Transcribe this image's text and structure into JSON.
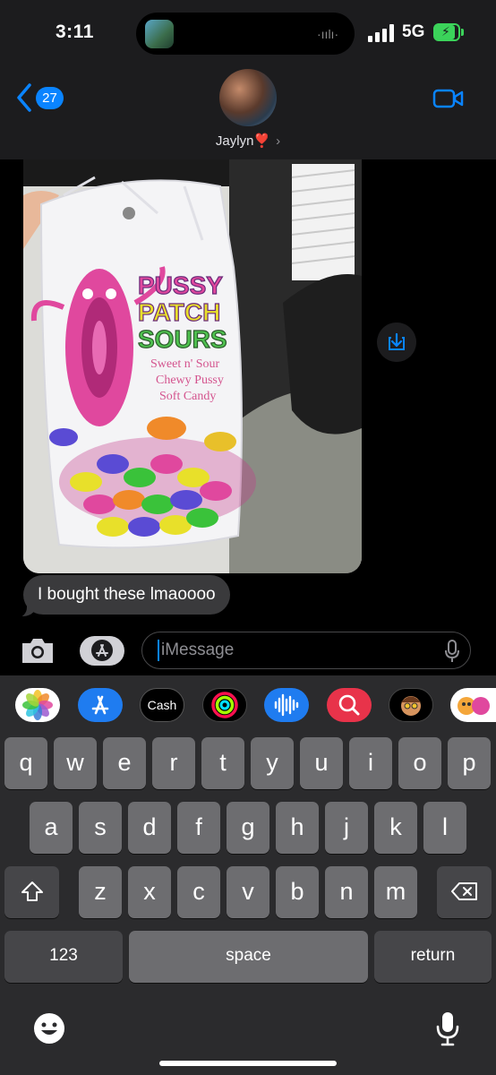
{
  "status": {
    "time": "3:11",
    "network": "5G"
  },
  "header": {
    "back_count": "27",
    "contact_name": "Jaylyn❣️"
  },
  "photo": {
    "package_text": [
      "PUSSY",
      "PATCH",
      "SOURS"
    ],
    "tagline": [
      "Sweet n' Sour",
      "Chewy Pussy",
      "Soft Candy"
    ]
  },
  "message": {
    "text": "I bought these lmaoooo"
  },
  "input": {
    "placeholder": "iMessage"
  },
  "app_drawer": {
    "cash_label": "Cash"
  },
  "keyboard": {
    "row1": [
      "q",
      "w",
      "e",
      "r",
      "t",
      "y",
      "u",
      "i",
      "o",
      "p"
    ],
    "row2": [
      "a",
      "s",
      "d",
      "f",
      "g",
      "h",
      "j",
      "k",
      "l"
    ],
    "row3": [
      "z",
      "x",
      "c",
      "v",
      "b",
      "n",
      "m"
    ],
    "numbers_label": "123",
    "space_label": "space",
    "return_label": "return"
  }
}
